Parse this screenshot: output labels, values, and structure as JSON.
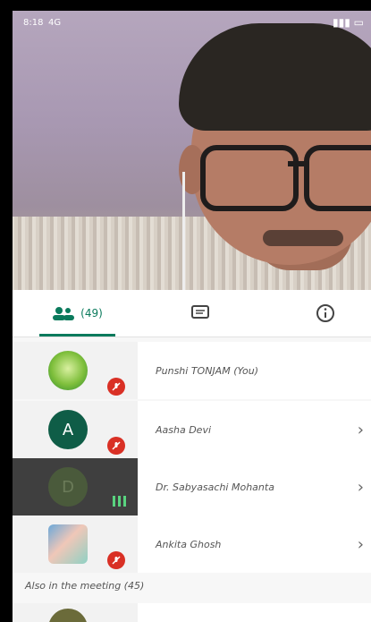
{
  "status_bar": {
    "time": "8:18",
    "network": "4G"
  },
  "tabs": {
    "people_count": "(49)"
  },
  "participants": [
    {
      "name": "Punshi TONJAM (You)",
      "avatar_letter": "",
      "muted": true
    },
    {
      "name": "Aasha Devi",
      "avatar_letter": "A",
      "muted": true
    },
    {
      "name": "Dr. Sabyasachi Mohanta",
      "avatar_letter": "D",
      "muted": false
    },
    {
      "name": "Ankita Ghosh",
      "avatar_letter": "",
      "muted": true
    }
  ],
  "also_in_meeting": {
    "label": "Also in the meeting (45)"
  },
  "colors": {
    "accent": "#0a7a5c",
    "mute_red": "#d93025"
  }
}
